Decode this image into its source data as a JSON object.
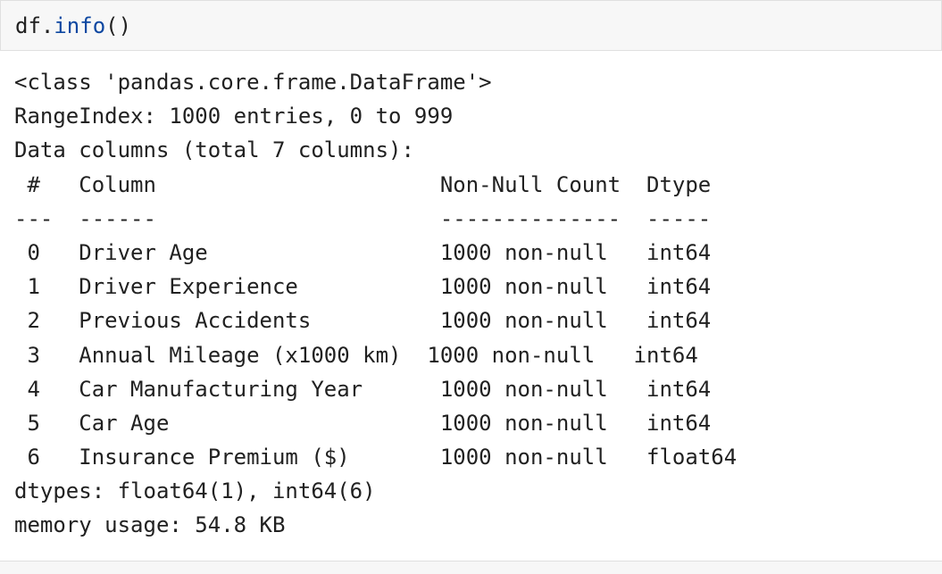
{
  "input_cell": {
    "code_object": "df",
    "code_dot": ".",
    "code_method": "info",
    "code_parens": "()"
  },
  "output": {
    "lines": [
      "<class 'pandas.core.frame.DataFrame'>",
      "RangeIndex: 1000 entries, 0 to 999",
      "Data columns (total 7 columns):",
      " #   Column                      Non-Null Count  Dtype  ",
      "---  ------                      --------------  -----  ",
      " 0   Driver Age                  1000 non-null   int64  ",
      " 1   Driver Experience           1000 non-null   int64  ",
      " 2   Previous Accidents          1000 non-null   int64  ",
      " 3   Annual Mileage (x1000 km)  1000 non-null   int64  ",
      " 4   Car Manufacturing Year      1000 non-null   int64  ",
      " 5   Car Age                     1000 non-null   int64  ",
      " 6   Insurance Premium ($)       1000 non-null   float64",
      "dtypes: float64(1), int64(6)",
      "memory usage: 54.8 KB"
    ]
  }
}
